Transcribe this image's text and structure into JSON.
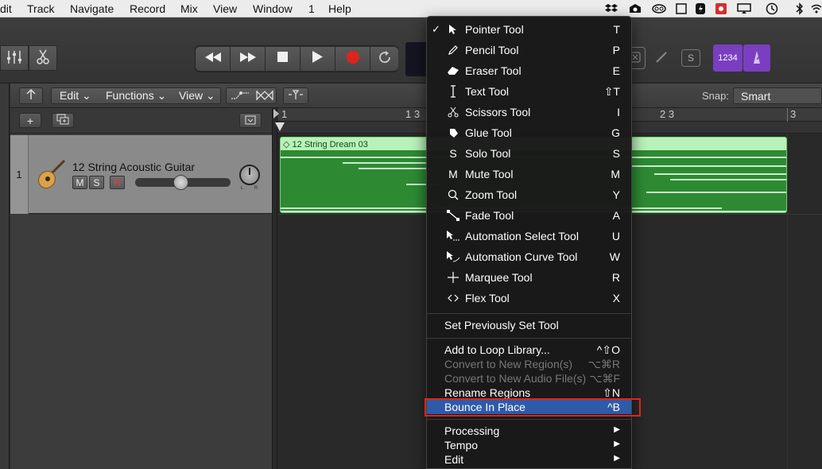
{
  "menubar": {
    "items": [
      "dit",
      "Track",
      "Navigate",
      "Record",
      "Mix",
      "View",
      "Window",
      "1",
      "Help"
    ]
  },
  "local_bar": {
    "edit": "Edit",
    "functions": "Functions",
    "view": "View",
    "snap_label": "Snap:",
    "snap_value": "Smart"
  },
  "count_in": "1234",
  "ruler": {
    "labels": [
      "1",
      "1 3",
      "2 3",
      "3"
    ]
  },
  "track": {
    "number": "1",
    "name": "12 String Acoustic Guitar",
    "mute": "M",
    "solo": "S",
    "record": "R",
    "pan_l": "L",
    "pan_r": "R"
  },
  "region": {
    "name": "12 String Dream 03"
  },
  "tools_menu": {
    "items": [
      {
        "label": "Pointer Tool",
        "shortcut": "T",
        "checked": true
      },
      {
        "label": "Pencil Tool",
        "shortcut": "P"
      },
      {
        "label": "Eraser Tool",
        "shortcut": "E"
      },
      {
        "label": "Text Tool",
        "shortcut": "⇧T"
      },
      {
        "label": "Scissors Tool",
        "shortcut": "I"
      },
      {
        "label": "Glue Tool",
        "shortcut": "G"
      },
      {
        "label": "Solo Tool",
        "shortcut": "S"
      },
      {
        "label": "Mute Tool",
        "shortcut": "M"
      },
      {
        "label": "Zoom Tool",
        "shortcut": "Y"
      },
      {
        "label": "Fade Tool",
        "shortcut": "A"
      },
      {
        "label": "Automation Select Tool",
        "shortcut": "U"
      },
      {
        "label": "Automation Curve Tool",
        "shortcut": "W"
      },
      {
        "label": "Marquee Tool",
        "shortcut": "R"
      },
      {
        "label": "Flex Tool",
        "shortcut": "X"
      }
    ],
    "set_previous": "Set Previously Set Tool",
    "region_items": [
      {
        "label": "Add to Loop Library...",
        "shortcut": "^⇧O",
        "disabled": false
      },
      {
        "label": "Convert to New Region(s)",
        "shortcut": "⌥⌘R",
        "disabled": true
      },
      {
        "label": "Convert to New Audio File(s)",
        "shortcut": "⌥⌘F",
        "disabled": true
      },
      {
        "label": "Rename Regions",
        "shortcut": "⇧N",
        "disabled": false
      },
      {
        "label": "Bounce In Place",
        "shortcut": "^B",
        "disabled": false
      }
    ],
    "submenus": [
      "Processing",
      "Tempo",
      "Edit"
    ]
  },
  "colors": {
    "menu_highlight": "#2f5aa8",
    "annotation_box": "#e0241c",
    "region_green": "#2d8a33",
    "count_in_purple": "#7a3fc0"
  }
}
